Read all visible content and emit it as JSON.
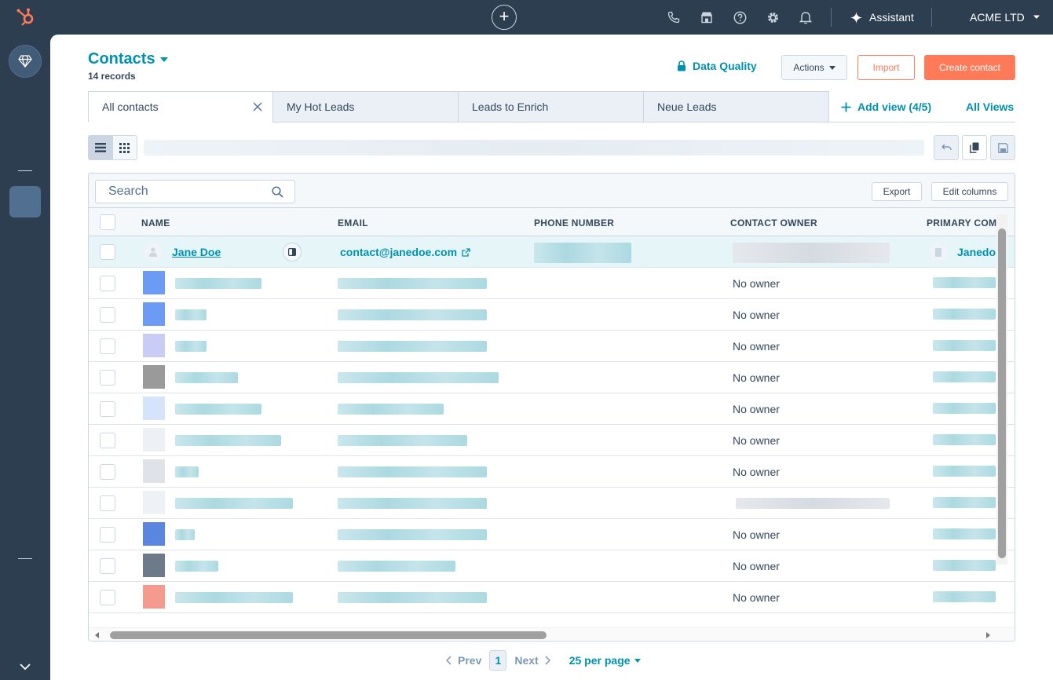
{
  "topbar": {
    "plus_label": "+",
    "assistant_label": "Assistant",
    "account_name": "ACME LTD",
    "icons": [
      "phone-icon",
      "marketplace-icon",
      "help-icon",
      "settings-icon",
      "notifications-icon"
    ]
  },
  "header": {
    "title": "Contacts",
    "record_count": "14 records",
    "data_quality_label": "Data Quality",
    "actions_label": "Actions",
    "import_label": "Import",
    "create_label": "Create contact"
  },
  "views": {
    "tabs": [
      {
        "label": "All contacts"
      },
      {
        "label": "My Hot Leads"
      },
      {
        "label": "Leads to Enrich"
      },
      {
        "label": "Neue Leads"
      }
    ],
    "add_view_label": "Add view (4/5)",
    "all_views_label": "All Views"
  },
  "table": {
    "search_placeholder": "Search",
    "export_label": "Export",
    "edit_columns_label": "Edit columns",
    "columns": [
      "NAME",
      "EMAIL",
      "PHONE NUMBER",
      "CONTACT OWNER",
      "PRIMARY COMPANY"
    ],
    "first_row": {
      "name": "Jane Doe",
      "email": "contact@janedoe.com",
      "company": "Janedo"
    },
    "owners": [
      "No owner",
      "No owner",
      "No owner",
      "No owner",
      "No owner",
      "No owner",
      "No owner",
      "",
      "No owner",
      "No owner",
      "No owner"
    ]
  },
  "pagination": {
    "prev_label": "Prev",
    "page": "1",
    "next_label": "Next",
    "per_page_label": "25 per page"
  },
  "colors": {
    "accent": "#0091ae",
    "cta": "#ff7a59",
    "nav_bg": "#2d3e50",
    "border": "#cbd6e2"
  }
}
